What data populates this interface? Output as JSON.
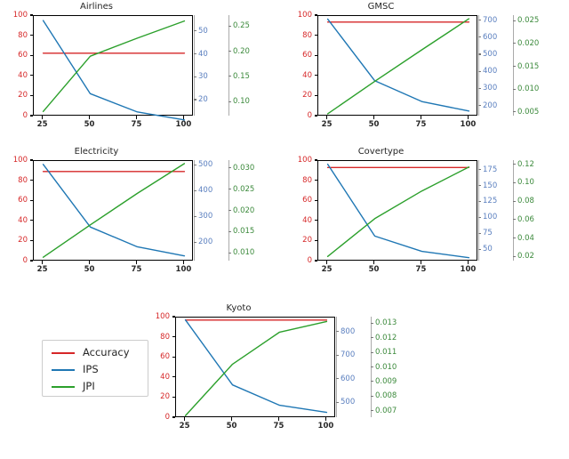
{
  "figure": {
    "legend": {
      "items": [
        {
          "label": "Accuracy",
          "color": "#d62728"
        },
        {
          "label": "IPS",
          "color": "#1f77b4"
        },
        {
          "label": "JPI",
          "color": "#2ca02c"
        }
      ]
    },
    "caption": ""
  },
  "chart_data": [
    {
      "type": "line",
      "title": "Airlines",
      "x": [
        25,
        50,
        75,
        100
      ],
      "xlabel": "",
      "xticks": [
        25,
        50,
        75,
        100
      ],
      "xlim": [
        20,
        105
      ],
      "grid": false,
      "legend_position": "figure-lower-left",
      "axes": [
        {
          "name": "Accuracy",
          "side": "left",
          "color": "#d62728",
          "ticks": [
            0,
            20,
            40,
            60,
            80,
            100
          ],
          "lim": [
            0,
            100
          ],
          "label": ""
        },
        {
          "name": "IPS",
          "side": "right",
          "color": "#5a7fbf",
          "ticks": [
            20,
            30,
            40,
            50
          ],
          "lim": [
            13,
            57
          ],
          "label": ""
        },
        {
          "name": "JPI",
          "side": "right2",
          "color": "#3c8a3c",
          "ticks": [
            0.1,
            0.15,
            0.2,
            0.25
          ],
          "lim": [
            0.072,
            0.272
          ],
          "label": ""
        }
      ],
      "series": [
        {
          "name": "Accuracy",
          "axis": "left",
          "color": "#d62728",
          "values": [
            63.0,
            63.0,
            63.0,
            63.0
          ]
        },
        {
          "name": "IPS",
          "axis": "right",
          "color": "#1f77b4",
          "values": [
            55.0,
            23.0,
            15.0,
            11.5
          ]
        },
        {
          "name": "JPI",
          "axis": "right2",
          "color": "#2ca02c",
          "values": [
            0.082,
            0.192,
            0.228,
            0.262
          ]
        }
      ]
    },
    {
      "type": "line",
      "title": "GMSC",
      "x": [
        25,
        50,
        75,
        100
      ],
      "xlabel": "",
      "xticks": [
        25,
        50,
        75,
        100
      ],
      "xlim": [
        20,
        105
      ],
      "grid": false,
      "axes": [
        {
          "name": "Accuracy",
          "side": "left",
          "color": "#d62728",
          "ticks": [
            0,
            20,
            40,
            60,
            80,
            100
          ],
          "lim": [
            0,
            100
          ],
          "label": ""
        },
        {
          "name": "IPS",
          "side": "right",
          "color": "#5a7fbf",
          "ticks": [
            200,
            300,
            400,
            500,
            600,
            700
          ],
          "lim": [
            140,
            730
          ],
          "label": ""
        },
        {
          "name": "JPI",
          "side": "right2",
          "color": "#3c8a3c",
          "ticks": [
            0.005,
            0.01,
            0.015,
            0.02,
            0.025
          ],
          "lim": [
            0.0042,
            0.0262
          ],
          "label": ""
        }
      ],
      "series": [
        {
          "name": "Accuracy",
          "axis": "left",
          "color": "#d62728",
          "values": [
            94.0,
            94.0,
            94.0,
            94.0
          ]
        },
        {
          "name": "IPS",
          "axis": "right",
          "color": "#1f77b4",
          "values": [
            712,
            350,
            228,
            172
          ]
        },
        {
          "name": "JPI",
          "axis": "right2",
          "color": "#2ca02c",
          "values": [
            0.0048,
            0.0119,
            0.0188,
            0.0256
          ]
        }
      ]
    },
    {
      "type": "line",
      "title": "Electricity",
      "x": [
        25,
        50,
        75,
        100
      ],
      "xlabel": "",
      "xticks": [
        25,
        50,
        75,
        100
      ],
      "xlim": [
        20,
        105
      ],
      "grid": false,
      "axes": [
        {
          "name": "Accuracy",
          "side": "left",
          "color": "#d62728",
          "ticks": [
            0,
            20,
            40,
            60,
            80,
            100
          ],
          "lim": [
            0,
            100
          ],
          "label": ""
        },
        {
          "name": "IPS",
          "side": "right",
          "color": "#5a7fbf",
          "ticks": [
            200,
            300,
            400,
            500
          ],
          "lim": [
            128,
            518
          ],
          "label": ""
        },
        {
          "name": "JPI",
          "side": "right2",
          "color": "#3c8a3c",
          "ticks": [
            0.01,
            0.015,
            0.02,
            0.025,
            0.03
          ],
          "lim": [
            0.0082,
            0.0318
          ],
          "label": ""
        }
      ],
      "series": [
        {
          "name": "Accuracy",
          "axis": "left",
          "color": "#d62728",
          "values": [
            89.5,
            89.5,
            89.5,
            89.5
          ]
        },
        {
          "name": "IPS",
          "axis": "right",
          "color": "#1f77b4",
          "values": [
            505,
            262,
            185,
            150
          ]
        },
        {
          "name": "JPI",
          "axis": "right2",
          "color": "#2ca02c",
          "values": [
            0.0092,
            0.0168,
            0.0242,
            0.0312
          ]
        }
      ]
    },
    {
      "type": "line",
      "title": "Covertype",
      "x": [
        25,
        50,
        75,
        100
      ],
      "xlabel": "",
      "xticks": [
        25,
        50,
        75,
        100
      ],
      "xlim": [
        20,
        105
      ],
      "grid": false,
      "axes": [
        {
          "name": "Accuracy",
          "side": "left",
          "color": "#d62728",
          "ticks": [
            0,
            20,
            40,
            60,
            80,
            100
          ],
          "lim": [
            0,
            100
          ],
          "label": ""
        },
        {
          "name": "IPS",
          "side": "right",
          "color": "#5a7fbf",
          "ticks": [
            50,
            75,
            100,
            125,
            150,
            175
          ],
          "lim": [
            32,
            190
          ],
          "label": ""
        },
        {
          "name": "JPI",
          "side": "right2",
          "color": "#3c8a3c",
          "ticks": [
            0.02,
            0.04,
            0.06,
            0.08,
            0.1,
            0.12
          ],
          "lim": [
            0.0155,
            0.1245
          ],
          "label": ""
        }
      ],
      "series": [
        {
          "name": "Accuracy",
          "axis": "left",
          "color": "#d62728",
          "values": [
            93.5,
            93.5,
            93.5,
            93.5
          ]
        },
        {
          "name": "IPS",
          "axis": "right",
          "color": "#1f77b4",
          "values": [
            185,
            72,
            48,
            38
          ]
        },
        {
          "name": "JPI",
          "axis": "right2",
          "color": "#2ca02c",
          "values": [
            0.021,
            0.062,
            0.092,
            0.118
          ]
        }
      ]
    },
    {
      "type": "line",
      "title": "Kyoto",
      "x": [
        25,
        50,
        75,
        100
      ],
      "xlabel": "",
      "xticks": [
        25,
        50,
        75,
        100
      ],
      "xlim": [
        20,
        105
      ],
      "grid": false,
      "axes": [
        {
          "name": "Accuracy",
          "side": "left",
          "color": "#d62728",
          "ticks": [
            0,
            20,
            40,
            60,
            80,
            100
          ],
          "lim": [
            0,
            100
          ],
          "label": ""
        },
        {
          "name": "IPS",
          "side": "right",
          "color": "#5a7fbf",
          "ticks": [
            500,
            600,
            700,
            800
          ],
          "lim": [
            438,
            862
          ],
          "label": ""
        },
        {
          "name": "JPI",
          "side": "right2",
          "color": "#3c8a3c",
          "ticks": [
            0.007,
            0.008,
            0.009,
            0.01,
            0.011,
            0.012,
            0.013
          ],
          "lim": [
            0.00655,
            0.01345
          ],
          "label": ""
        }
      ],
      "series": [
        {
          "name": "Accuracy",
          "axis": "left",
          "color": "#d62728",
          "values": [
            97.5,
            97.5,
            97.5,
            97.5
          ]
        },
        {
          "name": "IPS",
          "axis": "right",
          "color": "#1f77b4",
          "values": [
            852,
            578,
            492,
            462
          ]
        },
        {
          "name": "JPI",
          "axis": "right2",
          "color": "#2ca02c",
          "values": [
            0.00672,
            0.01025,
            0.01245,
            0.01318
          ]
        }
      ]
    }
  ]
}
